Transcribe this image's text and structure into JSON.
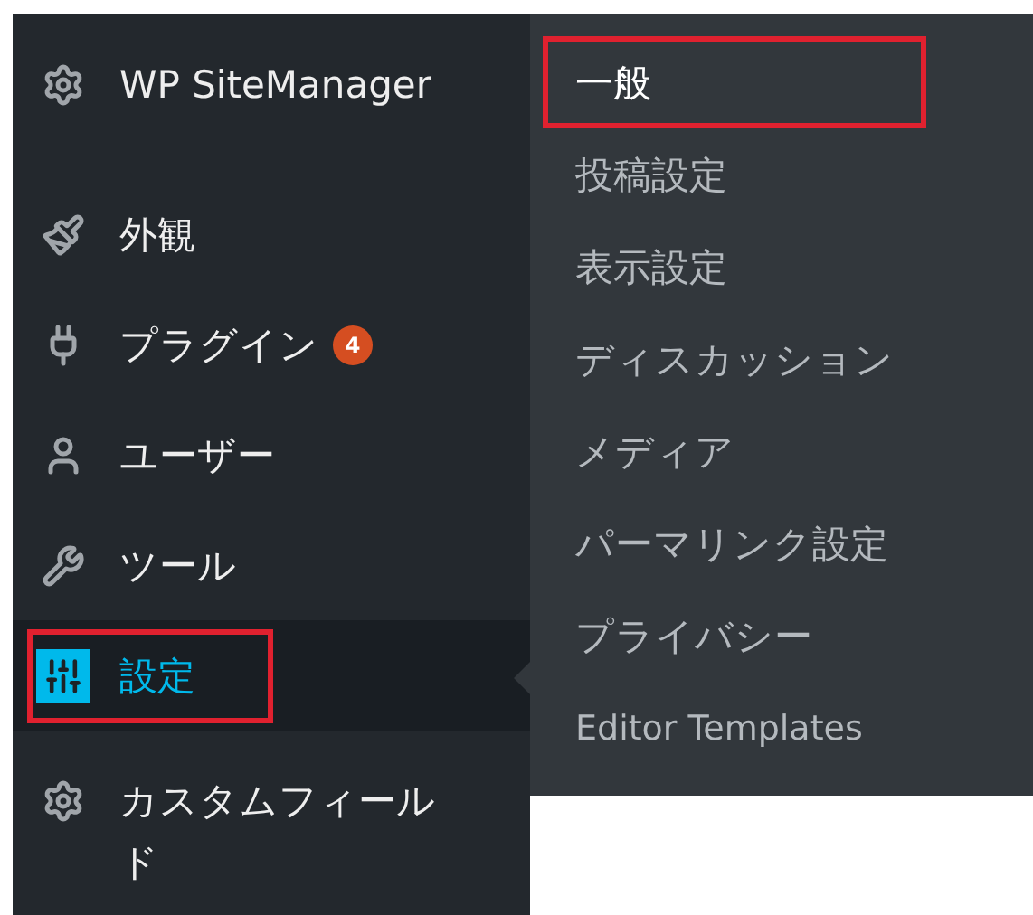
{
  "menu": [
    {
      "label": "WP SiteManager",
      "kind": "gear",
      "current": false,
      "annotated": false
    },
    {
      "label": "外観",
      "kind": "brush",
      "current": false,
      "annotated": false
    },
    {
      "label": "プラグイン",
      "kind": "plug",
      "current": false,
      "annotated": false,
      "badge": "4"
    },
    {
      "label": "ユーザー",
      "kind": "user",
      "current": false,
      "annotated": false
    },
    {
      "label": "ツール",
      "kind": "wrench",
      "current": false,
      "annotated": false
    },
    {
      "label": "設定",
      "kind": "settings",
      "current": true,
      "annotated": true
    },
    {
      "label": "カスタムフィールド",
      "kind": "gear",
      "current": false,
      "annotated": false
    }
  ],
  "submenu": {
    "items": [
      {
        "label": "一般",
        "selected": true,
        "annotated": true
      },
      {
        "label": "投稿設定",
        "selected": false,
        "annotated": false
      },
      {
        "label": "表示設定",
        "selected": false,
        "annotated": false
      },
      {
        "label": "ディスカッション",
        "selected": false,
        "annotated": false
      },
      {
        "label": "メディア",
        "selected": false,
        "annotated": false
      },
      {
        "label": "パーマリンク設定",
        "selected": false,
        "annotated": false
      },
      {
        "label": "プライバシー",
        "selected": false,
        "annotated": false
      },
      {
        "label": "Editor Templates",
        "selected": false,
        "annotated": false
      }
    ]
  }
}
